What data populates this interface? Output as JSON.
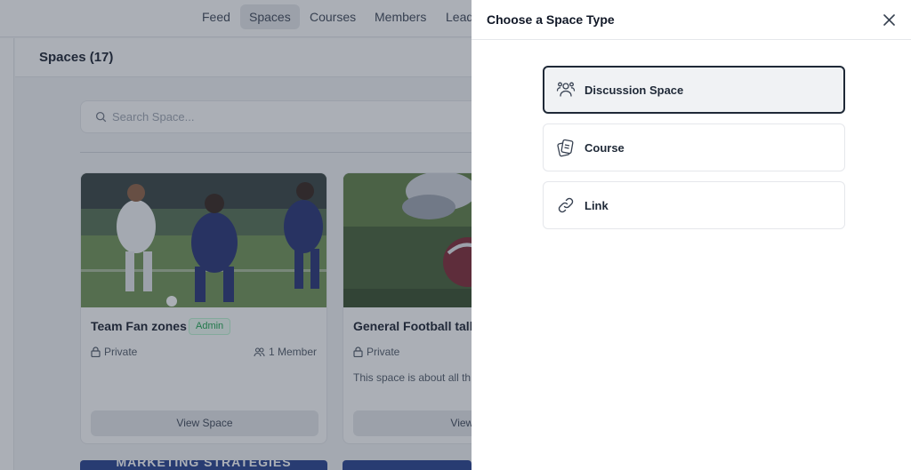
{
  "nav": {
    "items": [
      {
        "label": "Feed",
        "active": false
      },
      {
        "label": "Spaces",
        "active": true
      },
      {
        "label": "Courses",
        "active": false
      },
      {
        "label": "Members",
        "active": false
      },
      {
        "label": "Lead",
        "active": false
      }
    ]
  },
  "header": {
    "title": "Spaces (17)"
  },
  "search": {
    "placeholder": "Search Space...",
    "icon": "search-icon"
  },
  "cards": [
    {
      "title": "Team Fan zones",
      "badge": "Admin",
      "privacy": "Private",
      "members": "1 Member",
      "description": "",
      "button": "View Space"
    },
    {
      "title": "General Football talk",
      "badge": "",
      "privacy": "Private",
      "members": "",
      "description": "This space is about all th",
      "button": "View S"
    }
  ],
  "banners": [
    {
      "text": "MARKETING STRATEGIES"
    },
    {
      "text": ""
    }
  ],
  "drawer": {
    "title": "Choose a Space Type",
    "close_icon": "close-icon",
    "options": [
      {
        "label": "Discussion Space",
        "icon": "users-icon",
        "selected": true
      },
      {
        "label": "Course",
        "icon": "course-cards-icon",
        "selected": false
      },
      {
        "label": "Link",
        "icon": "link-icon",
        "selected": false
      }
    ]
  },
  "colors": {
    "accent": "#1f2937",
    "badge_green": "#16a34a",
    "banner_blue": "#1e3a8a",
    "overlay": "#374151"
  }
}
